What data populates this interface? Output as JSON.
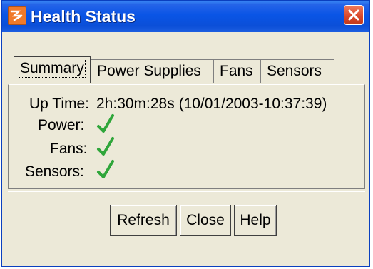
{
  "window": {
    "title": "Health Status",
    "close_icon": "close-icon",
    "app_icon": "app-icon"
  },
  "tabs": [
    {
      "label": "Summary",
      "active": true
    },
    {
      "label": "Power Supplies",
      "active": false
    },
    {
      "label": "Fans",
      "active": false
    },
    {
      "label": "Sensors",
      "active": false
    }
  ],
  "summary": {
    "uptime_label": "Up Time:",
    "uptime_value": "2h:30m:28s (10/01/2003-10:37:39)",
    "power_label": "Power:",
    "power_status_icon": "checkmark-icon",
    "fans_label": "Fans:",
    "fans_status_icon": "checkmark-icon",
    "sensors_label": "Sensors:",
    "sensors_status_icon": "checkmark-icon"
  },
  "buttons": {
    "refresh": "Refresh",
    "close": "Close",
    "help": "Help"
  },
  "colors": {
    "titlebar": "#0a55e6",
    "dialog_bg": "#ece9d8",
    "check": "#2fa63a"
  }
}
